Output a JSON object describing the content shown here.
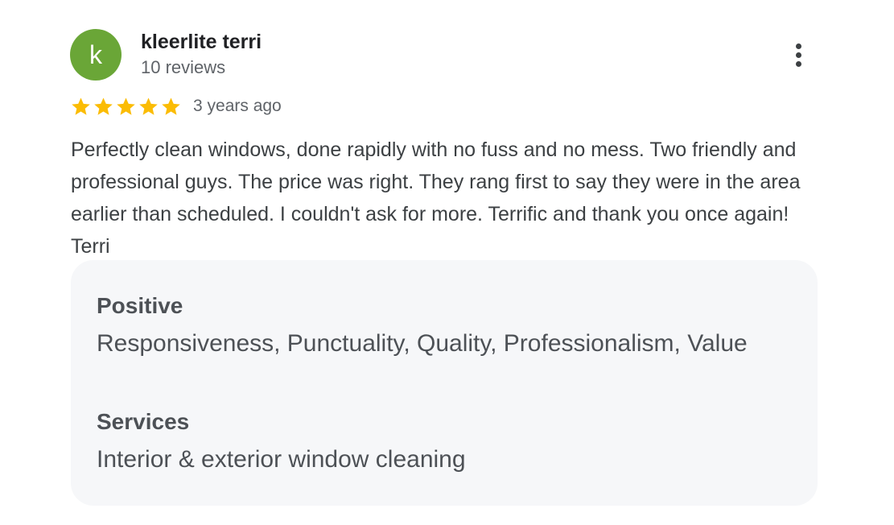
{
  "reviewer": {
    "avatar_letter": "k",
    "avatar_color": "#6aa637",
    "name": "kleerlite terri",
    "meta": "10 reviews"
  },
  "rating": {
    "stars": 5,
    "max_stars": 5,
    "star_color": "#fbbc04",
    "date": "3 years ago"
  },
  "review": {
    "text": "Perfectly clean windows, done rapidly with no fuss and no mess. Two friendly and professional guys. The price was right. They rang first to say they were in the area earlier than scheduled. I couldn't ask for more. Terrific and thank you once again! Terri"
  },
  "attributes": {
    "positive_heading": "Positive",
    "positive_value": "Responsiveness, Punctuality, Quality, Professionalism, Value",
    "services_heading": "Services",
    "services_value": "Interior & exterior window cleaning"
  },
  "icons": {
    "more": "more-vert-icon",
    "star": "star-icon"
  }
}
